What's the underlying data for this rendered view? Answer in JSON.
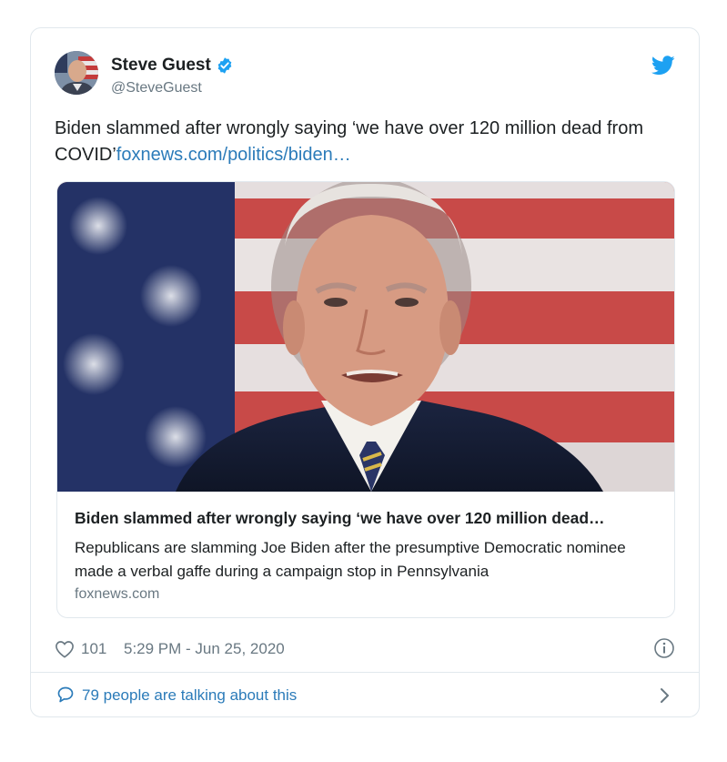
{
  "author": {
    "name": "Steve Guest",
    "handle": "@SteveGuest",
    "verified": true
  },
  "tweet": {
    "text": "Biden slammed after wrongly saying ‘we have over 120 million dead from COVID’",
    "link_text": "foxnews.com/politics/biden…"
  },
  "card": {
    "title": "Biden slammed after wrongly saying ‘we have over 120 million dead…",
    "description": "Republicans are slamming Joe Biden after the presumptive Democratic nominee made a verbal gaffe during a campaign stop in Pennsylvania",
    "domain": "foxnews.com"
  },
  "footer": {
    "like_count": "101",
    "timestamp": "5:29 PM - Jun 25, 2020",
    "conversation_label": "79 people are talking about this"
  },
  "icons": {
    "brand": "twitter-bird-icon",
    "verified": "verified-badge-icon",
    "like": "heart-icon",
    "info": "info-icon",
    "conversation": "speech-bubble-icon",
    "more": "chevron-right-icon"
  },
  "colors": {
    "twitter_blue": "#1da1f2",
    "link_blue": "#2b7bb9",
    "text_primary": "#1c2022",
    "text_secondary": "#697882",
    "border": "#e1e8ed"
  }
}
